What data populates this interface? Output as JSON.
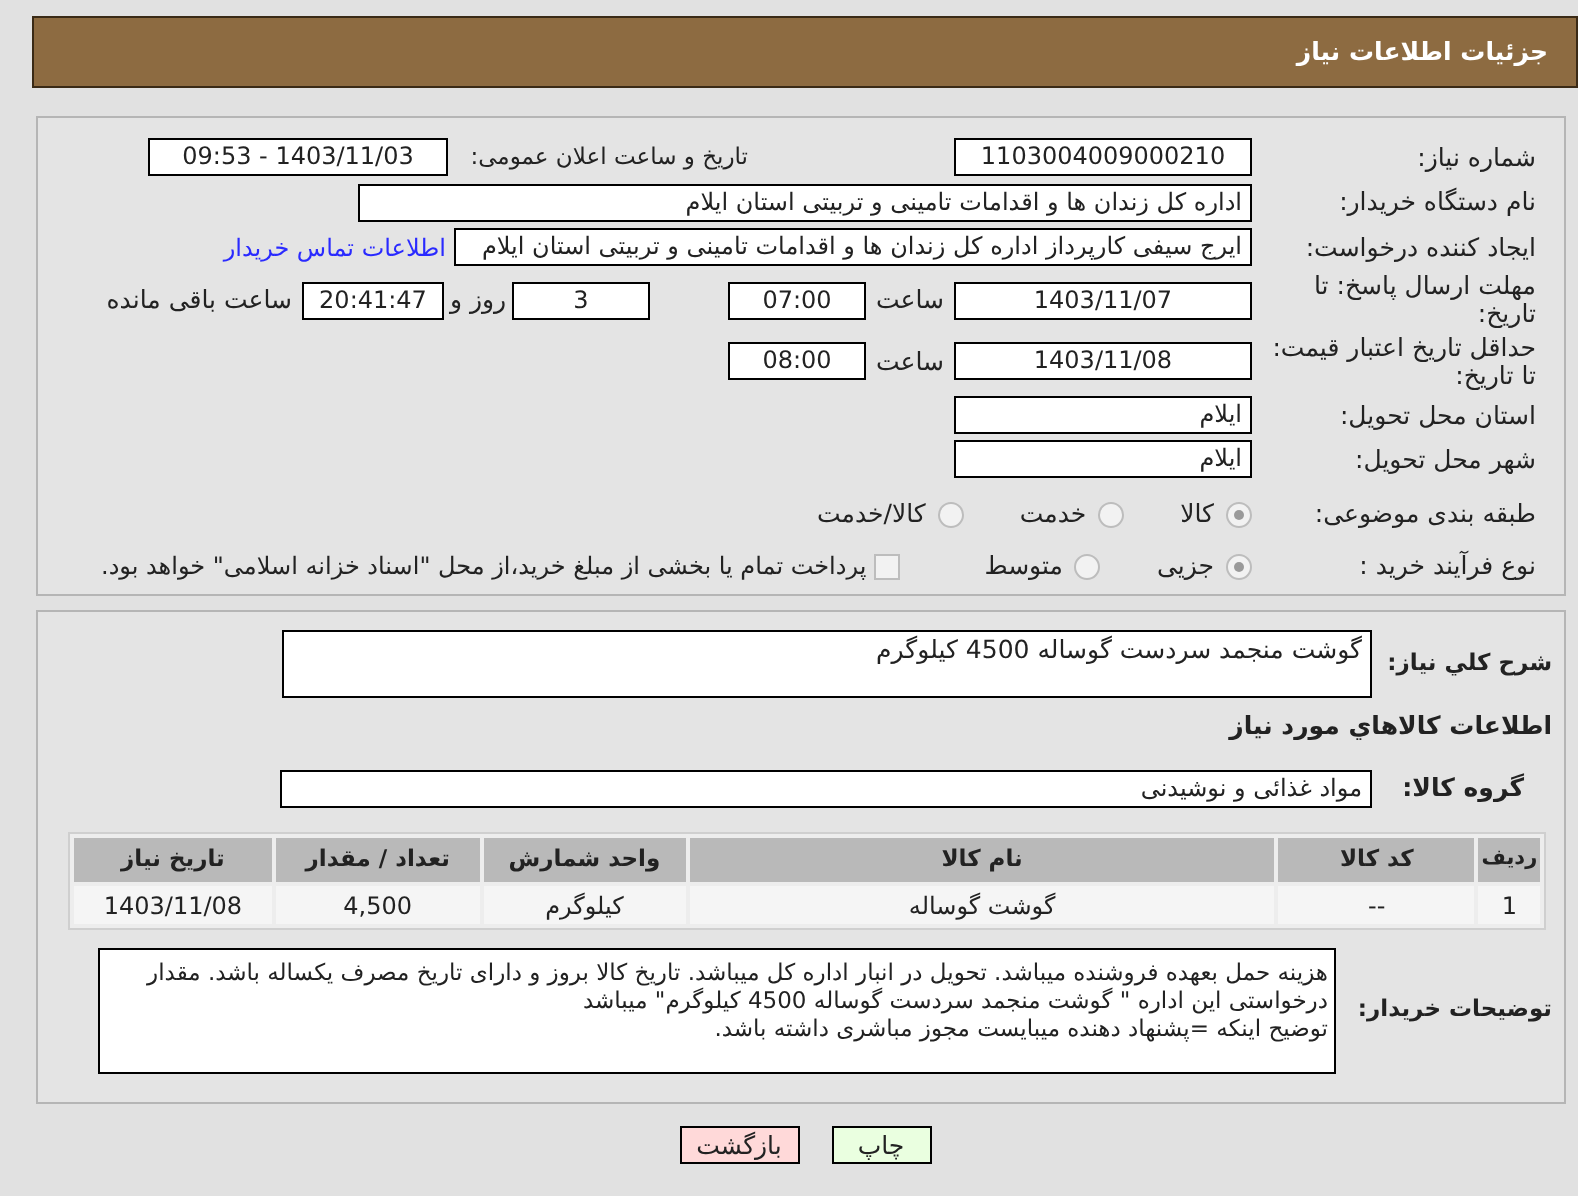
{
  "header": {
    "title": "جزئیات اطلاعات نیاز"
  },
  "need_number": {
    "label": "شماره نیاز:",
    "value": "1103004009000210"
  },
  "announce": {
    "label": "تاریخ و ساعت اعلان عمومی:",
    "value": "1403/11/03 - 09:53"
  },
  "buyer": {
    "label": "نام دستگاه خریدار:",
    "value": "اداره کل زندان ها و اقدامات تامینی و تربیتی استان ایلام"
  },
  "requester": {
    "label": "ایجاد کننده درخواست:",
    "value": "ایرج  سیفی کارپرداز اداره کل زندان ها و اقدامات تامینی و تربیتی استان ایلام",
    "link": "اطلاعات تماس خریدار"
  },
  "deadline": {
    "label": "مهلت ارسال پاسخ: تا تاریخ:",
    "date": "1403/11/07",
    "time_label": "ساعت",
    "time": "07:00",
    "days": "3",
    "days_label": "روز و",
    "remaining": "20:41:47",
    "remaining_label": "ساعت باقی مانده"
  },
  "validity": {
    "label": "حداقل تاریخ اعتبار قیمت: تا تاریخ:",
    "date": "1403/11/08",
    "time_label": "ساعت",
    "time": "08:00"
  },
  "province": {
    "label": "استان محل تحویل:",
    "value": "ایلام"
  },
  "city": {
    "label": "شهر محل تحویل:",
    "value": "ایلام"
  },
  "category": {
    "label": "طبقه بندی موضوعی:",
    "options": [
      {
        "label": "کالا",
        "selected": true
      },
      {
        "label": "خدمت",
        "selected": false
      },
      {
        "label": "کالا/خدمت",
        "selected": false
      }
    ]
  },
  "purchase_type": {
    "label": "نوع فرآیند خرید :",
    "options": [
      {
        "label": "جزیی",
        "selected": true
      },
      {
        "label": "متوسط",
        "selected": false
      }
    ],
    "payment": {
      "label": "پرداخت تمام یا بخشی از مبلغ خرید،از محل \"اسناد خزانه اسلامی\" خواهد بود.",
      "checked": false
    }
  },
  "summary": {
    "label": "شرح کلي نياز:",
    "value": "گوشت منجمد سردست گوساله 4500 کیلوگرم"
  },
  "goods_title": "اطلاعات کالاهاي مورد نياز",
  "goods_group": {
    "label": "گروه کالا:",
    "value": "مواد غذائی و نوشیدنی"
  },
  "table": {
    "columns": [
      "ردیف",
      "کد کالا",
      "نام کالا",
      "واحد شمارش",
      "تعداد / مقدار",
      "تاریخ نیاز"
    ],
    "rows": [
      [
        "1",
        "--",
        "گوشت گوساله",
        "کیلوگرم",
        "4,500",
        "1403/11/08"
      ]
    ]
  },
  "notes": {
    "label": "توضیحات خریدار:",
    "lines": [
      "هزینه حمل بعهده فروشنده میباشد. تحویل در انبار اداره کل میباشد. تاریخ کالا بروز و دارای تاریخ مصرف یکساله باشد. مقدار درخواستی این اداره \" گوشت منجمد سردست گوساله 4500 کیلوگرم\" میباشد",
      "توضیح اینکه =پشنهاد دهنده میبایست مجوز مباشری داشته باشد."
    ]
  },
  "buttons": [
    {
      "label": "چاپ",
      "kind": "print"
    },
    {
      "label": "بازگشت",
      "kind": "back"
    }
  ]
}
